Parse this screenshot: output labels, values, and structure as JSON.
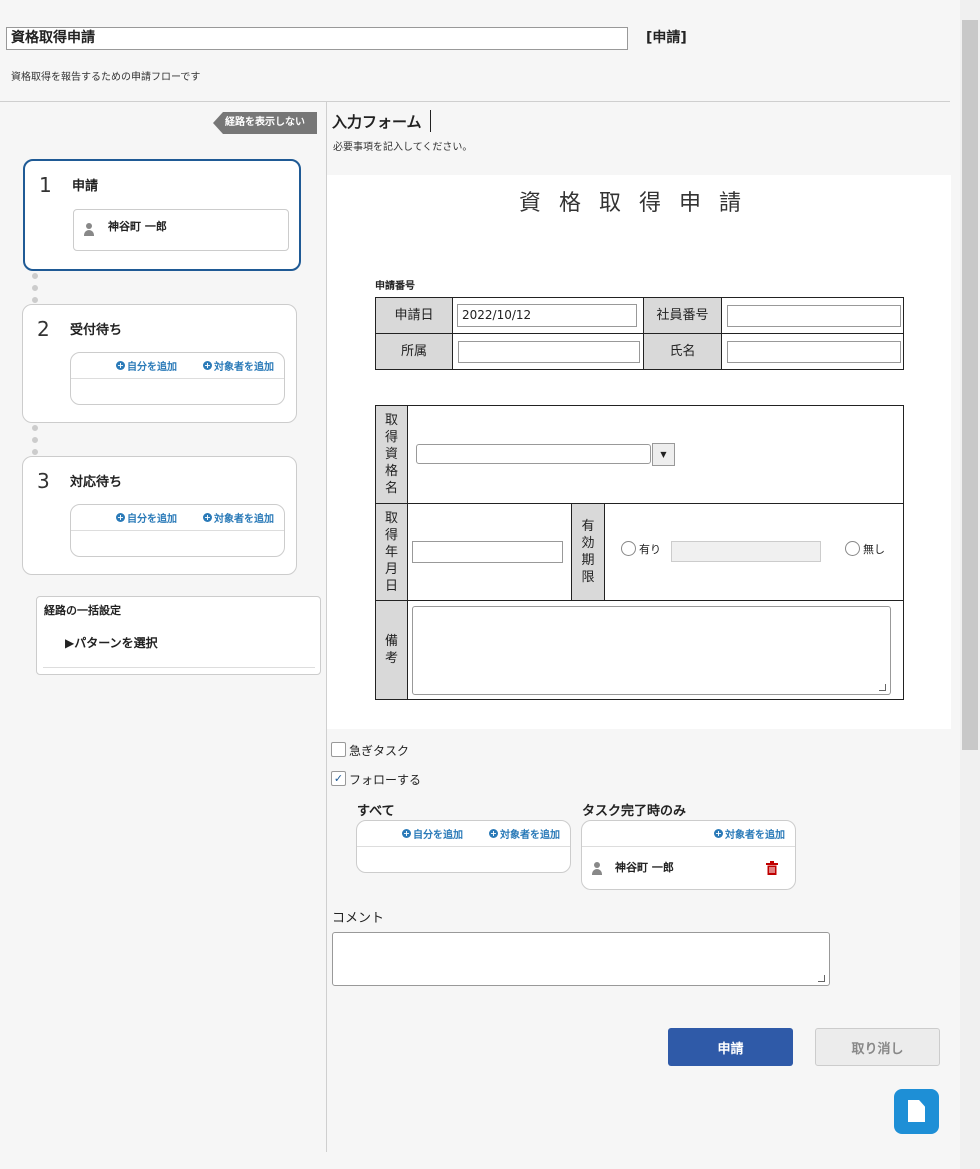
{
  "header": {
    "title": "資格取得申請",
    "tag": "[申請]",
    "subtitle": "資格取得を報告するための申請フローです"
  },
  "route": {
    "hide_label": "経路を表示しない",
    "steps": [
      {
        "num": "1",
        "name": "申請",
        "person": "神谷町 一郎"
      },
      {
        "num": "2",
        "name": "受付待ち",
        "add_self": "自分を追加",
        "add_target": "対象者を追加"
      },
      {
        "num": "3",
        "name": "対応待ち",
        "add_self": "自分を追加",
        "add_target": "対象者を追加"
      }
    ],
    "bulk": {
      "title": "経路の一括設定",
      "pattern": "▶パターンを選択"
    }
  },
  "form": {
    "title": "入力フォーム",
    "desc": "必要事項を記入してください。",
    "sheet_title": "資格取得申請",
    "app_no_label": "申請番号",
    "labels": {
      "apply_date": "申請日",
      "emp_no": "社員番号",
      "dept": "所属",
      "name": "氏名",
      "qual_name": [
        "取",
        "得",
        "資",
        "格",
        "名"
      ],
      "acq_date": [
        "取",
        "得",
        "年",
        "月",
        "日"
      ],
      "valid": [
        "有",
        "効",
        "期",
        "限"
      ],
      "note": [
        "備",
        "考"
      ]
    },
    "values": {
      "apply_date": "2022/10/12",
      "emp_no": "",
      "dept": "",
      "name": "",
      "qual_name": "",
      "acq_date": "",
      "valid_date": "",
      "note": ""
    },
    "radio": {
      "yes": "有り",
      "no": "無し"
    }
  },
  "options": {
    "urgent": "急ぎタスク",
    "follow": "フォローする",
    "follow_all": "すべて",
    "follow_done": "タスク完了時のみ",
    "add_self": "自分を追加",
    "add_target": "対象者を追加",
    "follow_person": "神谷町 一郎"
  },
  "comment": {
    "label": "コメント",
    "value": ""
  },
  "buttons": {
    "apply": "申請",
    "cancel": "取り消し"
  },
  "colors": {
    "primary": "#2f5aa8",
    "link": "#2a7ab8",
    "active_border": "#1f5a95",
    "delete": "#c00000"
  }
}
